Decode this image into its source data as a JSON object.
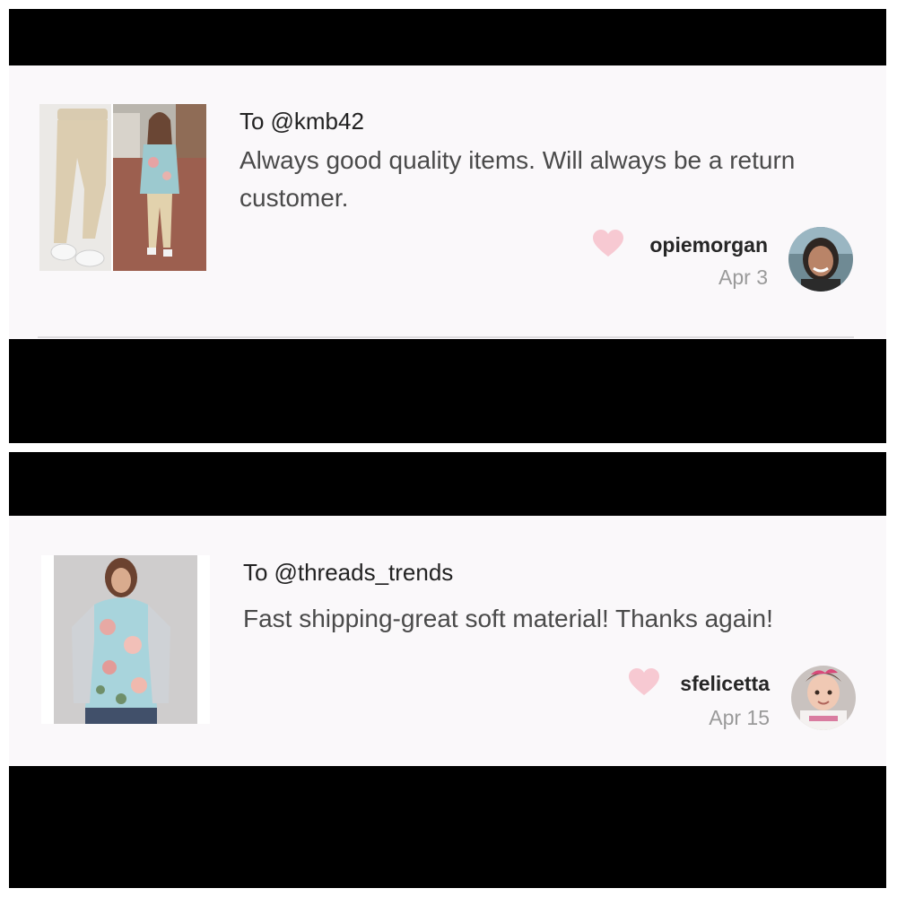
{
  "reviews": [
    {
      "to_prefix": "To",
      "to_handle": "@kmb42",
      "message": "Always good quality items. Will always be a return customer.",
      "username": "opiemorgan",
      "date": "Apr 3"
    },
    {
      "to_prefix": "To",
      "to_handle": "@threads_trends",
      "message": "Fast shipping-great soft material! Thanks again!",
      "username": "sfelicetta",
      "date": "Apr 15"
    }
  ],
  "colors": {
    "heart": "#f7c9d2",
    "background": "#faf8fa",
    "bar": "#000000"
  },
  "icons": {
    "like": "heart-icon",
    "avatar": "avatar"
  }
}
